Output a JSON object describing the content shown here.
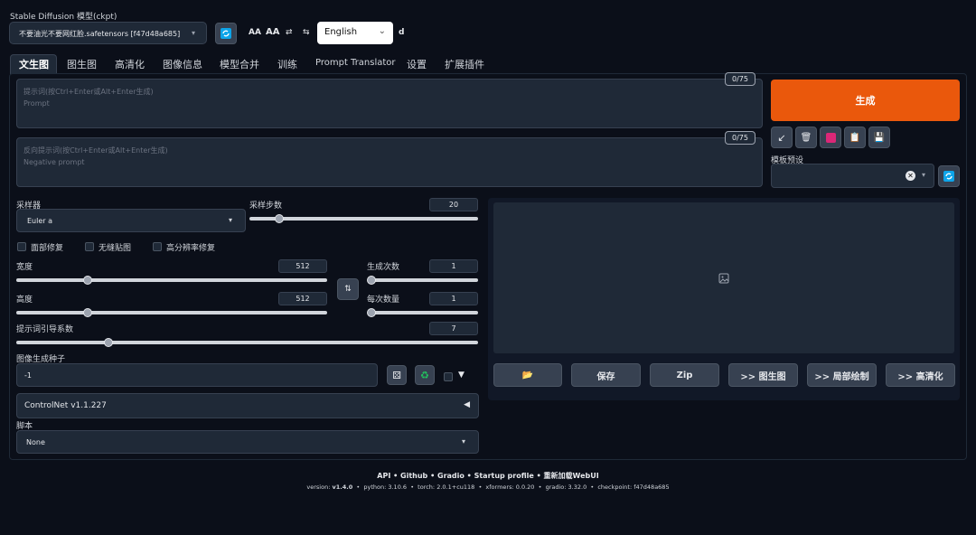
{
  "header": {
    "checkpoint_label": "Stable Diffusion 模型(ckpt)",
    "checkpoint_value": "不要油光不要网红脸.safetensors [f47d48a685]",
    "font_small": "AA",
    "font_large": "AA",
    "language_value": "English",
    "extra_letter": "d"
  },
  "tabs": [
    "文生图",
    "图生图",
    "高清化",
    "图像信息",
    "模型合并",
    "训练",
    "Prompt Translator",
    "设置",
    "扩展插件"
  ],
  "prompt": {
    "placeholder": "提示词(按Ctrl+Enter或Alt+Enter生成)",
    "sub": "Prompt",
    "token_count": "0/75"
  },
  "negative_prompt": {
    "placeholder": "反向提示词(按Ctrl+Enter或Alt+Enter生成)",
    "sub": "Negative prompt",
    "token_count": "0/75"
  },
  "generate_label": "生成",
  "styles_label": "模板预设",
  "sampler": {
    "label": "采样器",
    "value": "Euler a"
  },
  "steps": {
    "label": "采样步数",
    "value": "20"
  },
  "checks": {
    "face_restore": "面部修复",
    "tiling": "无缝贴图",
    "hires_fix": "高分辨率修复"
  },
  "width": {
    "label": "宽度",
    "value": "512"
  },
  "height": {
    "label": "高度",
    "value": "512"
  },
  "batch_count": {
    "label": "生成次数",
    "value": "1"
  },
  "batch_size": {
    "label": "每次数量",
    "value": "1"
  },
  "cfg": {
    "label": "提示词引导系数",
    "value": "7"
  },
  "seed": {
    "label": "图像生成种子",
    "value": "-1"
  },
  "controlnet_label": "ControlNet v1.1.227",
  "script": {
    "label": "脚本",
    "value": "None"
  },
  "gallery_buttons": {
    "folder": "📂",
    "save": "保存",
    "zip": "Zip",
    "to_img2img": ">> 图生图",
    "to_inpaint": ">> 局部绘制",
    "to_extras": ">> 高清化"
  },
  "footer": {
    "links": [
      "API",
      "Github",
      "Gradio",
      "Startup profile",
      "重新加载WebUI"
    ],
    "separator": "•",
    "versions": [
      {
        "k": "version:",
        "v": "v1.4.0"
      },
      {
        "k": "python:",
        "v": "3.10.6"
      },
      {
        "k": "torch:",
        "v": "2.0.1+cu118"
      },
      {
        "k": "xformers:",
        "v": "0.0.20"
      },
      {
        "k": "gradio:",
        "v": "3.32.0"
      },
      {
        "k": "checkpoint:",
        "v": "f47d48a685"
      }
    ]
  },
  "slider_levels": {
    "steps": 0.13,
    "width": 0.23,
    "height": 0.23,
    "batch_count": 0.0,
    "batch_size": 0.0,
    "cfg": 0.2
  },
  "colors": {
    "accent": "#ea580c",
    "background": "#0b0f19",
    "panel": "#1f2937"
  },
  "icons": [
    "refresh-icon",
    "swap-icon",
    "image-icon",
    "dice-icon",
    "recycle-icon",
    "folder-icon",
    "arrow-icon",
    "trash-icon",
    "pink-square-icon",
    "clipboard-icon",
    "save-icon"
  ]
}
